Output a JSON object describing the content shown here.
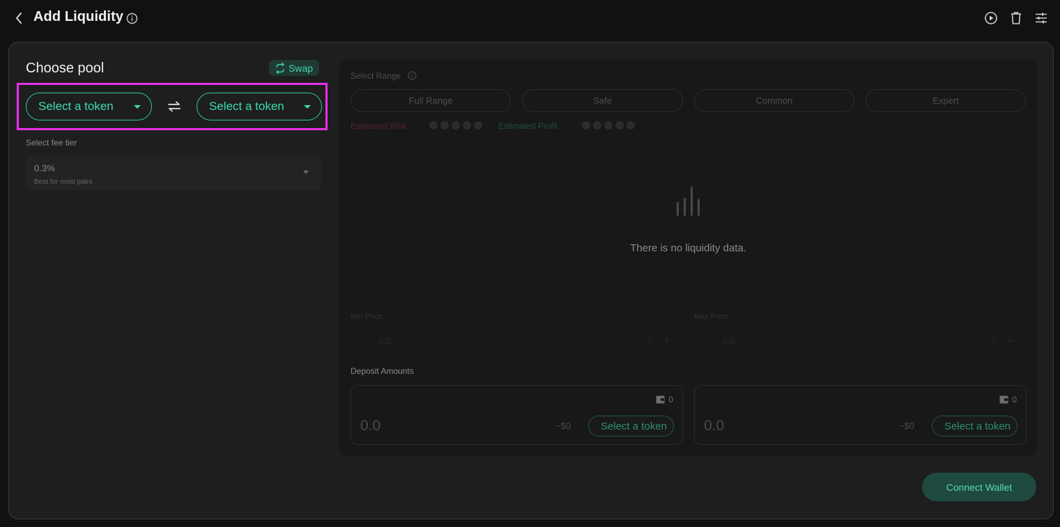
{
  "header": {
    "title": "Add Liquidity",
    "icons": [
      "back-icon",
      "info-icon",
      "play-icon",
      "trash-icon",
      "settings-sliders-icon"
    ]
  },
  "pool": {
    "title": "Choose pool",
    "swap_label": "Swap",
    "token_a_label": "Select a token",
    "token_b_label": "Select a token",
    "fee_tier_label": "Select fee tier",
    "fee_value": "0.3%",
    "fee_desc": "Best for most pairs"
  },
  "range": {
    "label": "Select Range",
    "buttons": [
      "Full Range",
      "Safe",
      "Common",
      "Expert"
    ],
    "risk_label": "Estimated Risk",
    "profit_label": "Estimated Profit",
    "no_data": "There is no liquidity data.",
    "min_price_label": "Min Price",
    "max_price_label": "Max Price",
    "min_price_value": "0.0",
    "max_price_value": "0.0"
  },
  "deposit": {
    "label": "Deposit Amounts",
    "boxes": [
      {
        "balance": "0",
        "amount": "0.0",
        "usd": "~$0",
        "token_label": "Select a token"
      },
      {
        "balance": "0",
        "amount": "0.0",
        "usd": "~$0",
        "token_label": "Select a token"
      }
    ]
  },
  "connect_label": "Connect Wallet",
  "colors": {
    "accent": "#3ddcb0",
    "highlight": "#ea2fea",
    "risk": "#b03050",
    "profit": "#2a9a7a"
  }
}
